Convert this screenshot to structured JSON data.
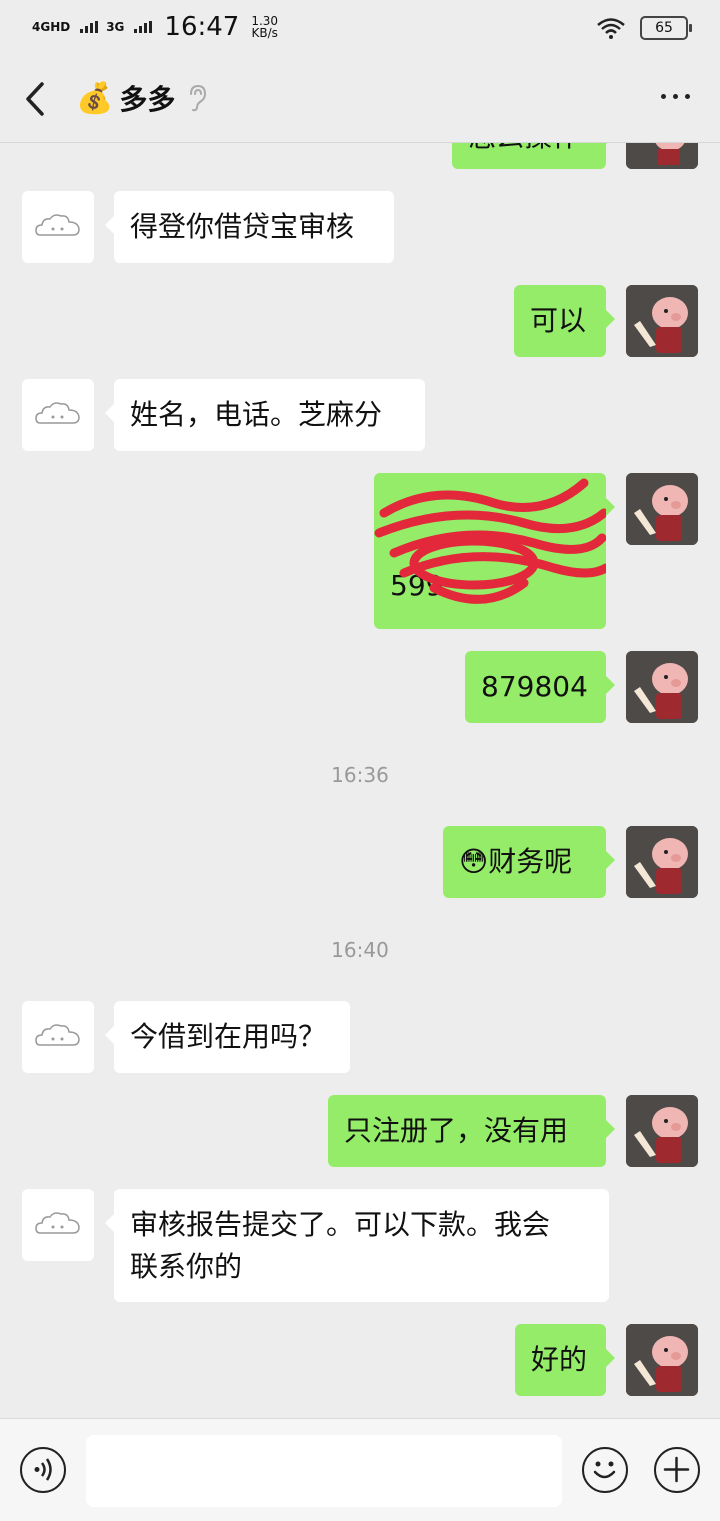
{
  "status_bar": {
    "network_1": "4GHD",
    "network_2": "3G",
    "time": "16:47",
    "speed_value": "1.30",
    "speed_unit": "KB/s",
    "battery": "65"
  },
  "header": {
    "title": "多多",
    "title_emoji": "💰"
  },
  "messages": {
    "partial_top": "怎么操作",
    "m1": "得登你借贷宝审核",
    "m2": "可以",
    "m3": "姓名，电话。芝麻分",
    "m4_visible": "599",
    "m5": "879804",
    "time1": "16:36",
    "m6_emoji": "😳",
    "m6_text": "财务呢",
    "time2": "16:40",
    "m7": "今借到在用吗？",
    "m8": "只注册了，没有用",
    "m9_line1": "审核报告提交了。可以下款。我会",
    "m9_line2": "联系你的",
    "m10": "好的"
  },
  "colors": {
    "background": "#ededed",
    "outgoing_bubble": "#95ec69",
    "incoming_bubble": "#ffffff",
    "scribble": "#e2283a"
  }
}
